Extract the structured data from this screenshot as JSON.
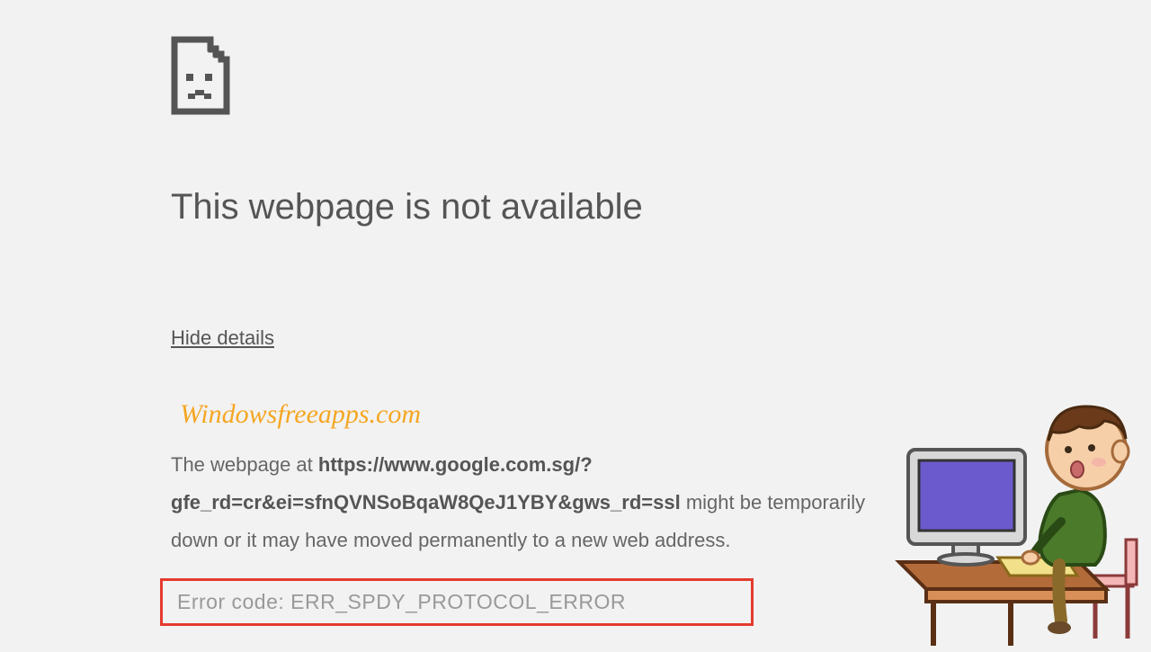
{
  "title": "This webpage is not available",
  "hide_details": "Hide details",
  "watermark": "Windowsfreeapps.com",
  "details": {
    "prefix": "The webpage at ",
    "url": "https://www.google.com.sg/?gfe_rd=cr&ei=sfnQVNSoBqaW8QeJ1YBY&gws_rd=ssl",
    "suffix": " might be temporarily down or it may have moved permanently to a new web address."
  },
  "error_code": "Error code: ERR_SPDY_PROTOCOL_ERROR"
}
